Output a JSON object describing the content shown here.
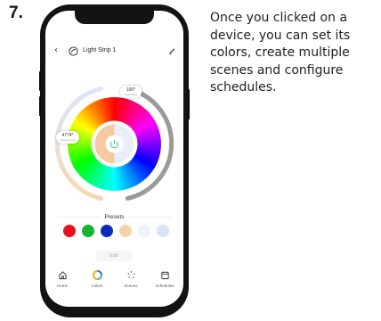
{
  "step_number": "7.",
  "description": "Once you clicked on a device, you can set its colors, create multiple scenes and configure schedules.",
  "app": {
    "header": {
      "back_icon": "chevron-left-icon",
      "device_icon": "light-strip-icon",
      "device_name": "Light Strip 1",
      "edit_icon": "pencil-icon"
    },
    "wheel": {
      "brightness_value": "100°",
      "brightness_sub": "Brightness",
      "temperature_value": "4774°",
      "temperature_sub": "Temperature",
      "center_icon": "power-icon",
      "brightness_level": 1.0
    },
    "presets": {
      "label": "Presets",
      "colors": [
        "#e8111a",
        "#14b52f",
        "#0c2bb8",
        "#f6d2ab",
        "#eef2fa",
        "#d7e3f6"
      ]
    },
    "edit_button": "Edit",
    "tabs": [
      {
        "label": "Home",
        "icon": "home-icon",
        "active": false
      },
      {
        "label": "Colors",
        "icon": "colors-icon",
        "active": true
      },
      {
        "label": "Scenes",
        "icon": "scenes-icon",
        "active": false
      },
      {
        "label": "Schedules",
        "icon": "schedules-icon",
        "active": false
      }
    ]
  }
}
